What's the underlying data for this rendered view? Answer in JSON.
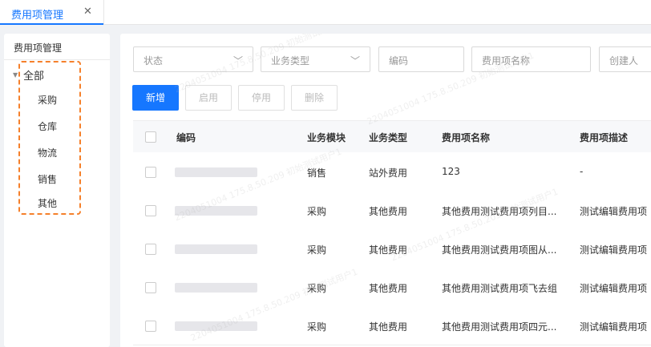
{
  "tabs": [
    {
      "label": "费用项管理",
      "close_icon": "close-icon"
    }
  ],
  "sidebar": {
    "title": "费用项管理",
    "tree": {
      "root": {
        "label": "全部",
        "expanded": true
      },
      "items": [
        {
          "label": "采购"
        },
        {
          "label": "仓库"
        },
        {
          "label": "物流"
        },
        {
          "label": "销售"
        },
        {
          "label": "其他"
        }
      ]
    },
    "highlight_color": "#f5802b"
  },
  "filters": {
    "status": {
      "placeholder": "状态"
    },
    "business_type": {
      "placeholder": "业务类型"
    },
    "code": {
      "placeholder": "编码"
    },
    "expense_name": {
      "placeholder": "费用项名称"
    },
    "creator": {
      "placeholder": "创建人"
    }
  },
  "toolbar": {
    "add_label": "新增",
    "enable_label": "启用",
    "disable_label": "停用",
    "delete_label": "删除",
    "primary_color": "#1677ff"
  },
  "table": {
    "columns": [
      "编码",
      "业务模块",
      "业务类型",
      "费用项名称",
      "费用项描述"
    ],
    "rows": [
      {
        "code": "",
        "module": "销售",
        "type": "站外费用",
        "name": "123",
        "desc": "-"
      },
      {
        "code": "",
        "module": "采购",
        "type": "其他费用",
        "name": "其他费用测试费用项列目...",
        "desc": "测试编辑费用项"
      },
      {
        "code": "",
        "module": "采购",
        "type": "其他费用",
        "name": "其他费用测试费用项图从...",
        "desc": "测试编辑费用项"
      },
      {
        "code": "",
        "module": "采购",
        "type": "其他费用",
        "name": "其他费用测试费用项飞去组",
        "desc": "测试编辑费用项"
      },
      {
        "code": "",
        "module": "采购",
        "type": "其他费用",
        "name": "其他费用测试费用项四元...",
        "desc": "测试编辑费用项"
      }
    ]
  },
  "watermark": {
    "text": "2204051004 175.8.50.209 初始测试用户1"
  }
}
